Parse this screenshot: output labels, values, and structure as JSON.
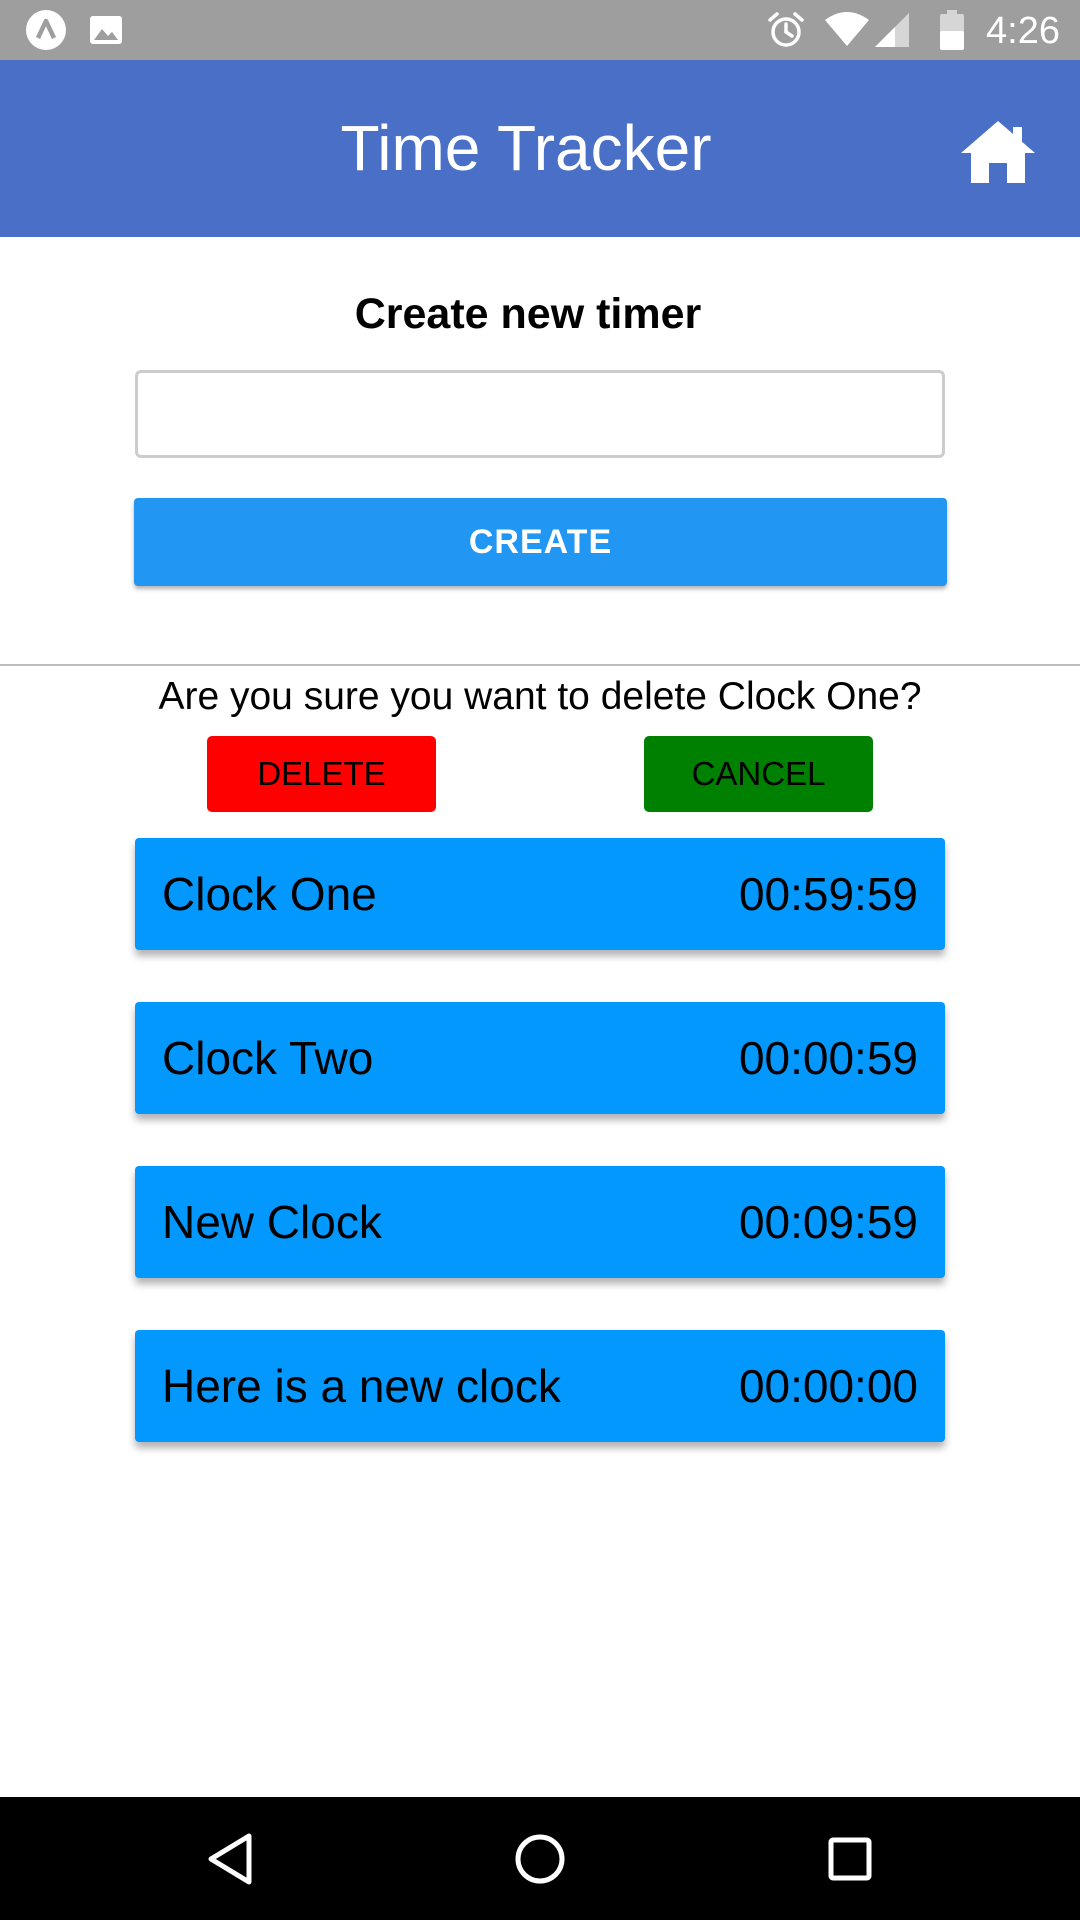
{
  "status_bar": {
    "time": "4:26",
    "left_icons": [
      "expo-app-icon",
      "image-icon"
    ],
    "right_icons": [
      "alarm-icon",
      "wifi-icon",
      "signal-icon",
      "battery-icon"
    ]
  },
  "app_bar": {
    "title": "Time Tracker",
    "home_icon": "home-icon",
    "color": "#4a6fc6"
  },
  "create_form": {
    "heading": "Create new timer",
    "input_value": "",
    "create_label": "CREATE",
    "button_color": "#2196f3"
  },
  "delete_confirm": {
    "message": "Are you sure you want to delete Clock One?",
    "delete_label": "DELETE",
    "cancel_label": "CANCEL",
    "delete_color": "#ff0000",
    "cancel_color": "#008000"
  },
  "timers": [
    {
      "name": "Clock One",
      "time": "00:59:59"
    },
    {
      "name": "Clock Two",
      "time": "00:00:59"
    },
    {
      "name": "New Clock",
      "time": "00:09:59"
    },
    {
      "name": "Here is a new clock",
      "time": "00:00:00"
    }
  ],
  "timer_color": "#0398fd",
  "nav_bar": {
    "icons": [
      "back-icon",
      "home-circle-icon",
      "recents-icon"
    ]
  }
}
